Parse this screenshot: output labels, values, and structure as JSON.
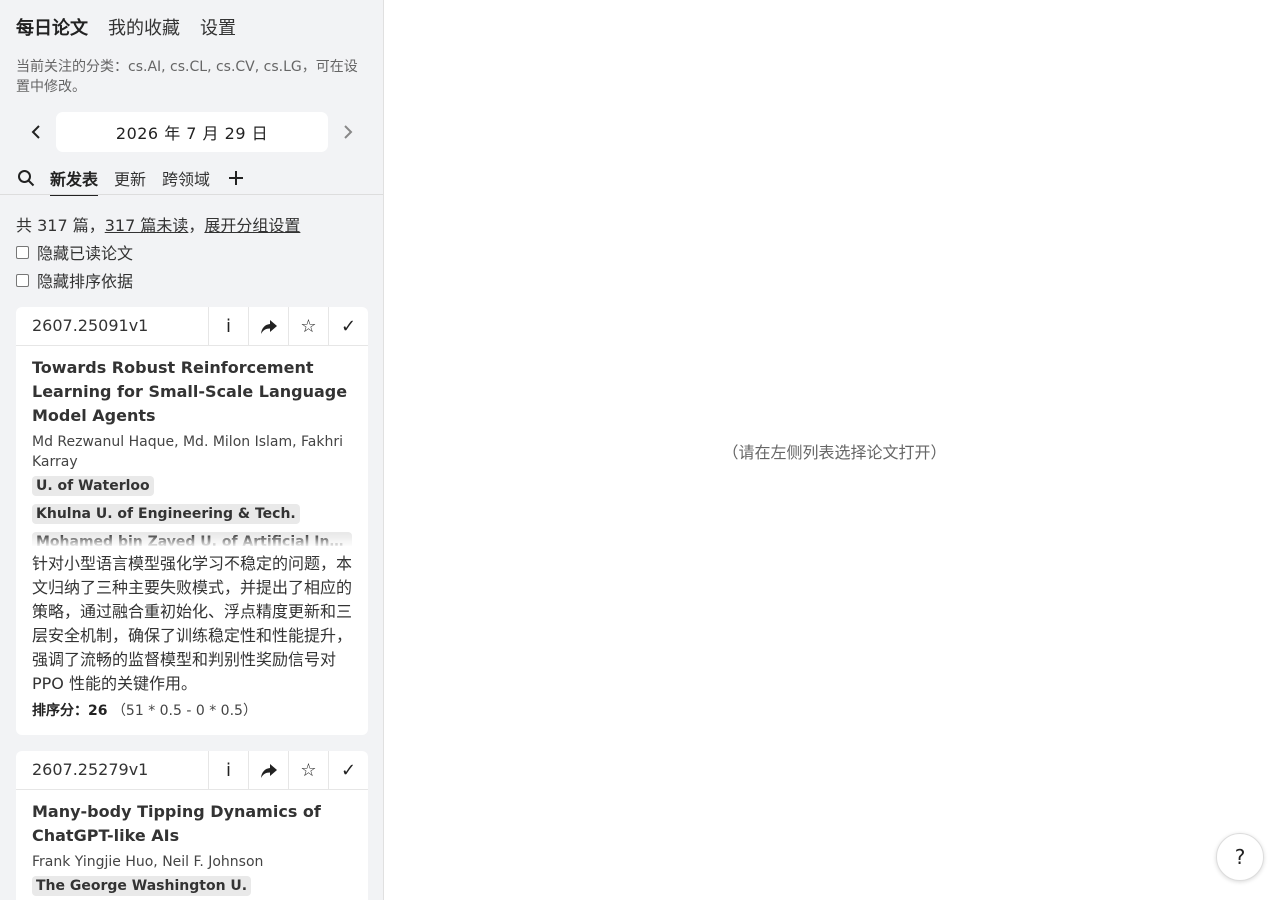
{
  "nav": {
    "daily": "每日论文",
    "favorites": "我的收藏",
    "settings": "设置"
  },
  "category_note": "当前关注的分类：cs.AI, cs.CL, cs.CV, cs.LG，可在设置中修改。",
  "date": {
    "label": "2026 年 7 月 29 日"
  },
  "tabs": {
    "new": "新发表",
    "updated": "更新",
    "cross": "跨领域",
    "add": "+"
  },
  "summary": {
    "total": "共 317 篇，",
    "unread": "317 篇未读",
    "sep": "，",
    "group_settings": "展开分组设置"
  },
  "filters": {
    "hide_read": "隐藏已读论文",
    "hide_ranking": "隐藏排序依据"
  },
  "papers": [
    {
      "id": "2607.25091v1",
      "title": "Towards Robust Reinforcement Learning for Small-Scale Language Model Agents",
      "authors": "Md Rezwanul Haque, Md. Milon Islam, Fakhri Karray",
      "affiliations": [
        "U. of Waterloo",
        "Khulna U. of Engineering & Tech.",
        "Mohamed bin Zayed U. of Artificial Intelligence"
      ],
      "summary": "针对小型语言模型强化学习不稳定的问题，本文归纳了三种主要失败模式，并提出了相应的策略，通过融合重初始化、浮点精度更新和三层安全机制，确保了训练稳定性和性能提升，强调了流畅的监督模型和判别性奖励信号对 PPO 性能的关键作用。",
      "score_label": "排序分：",
      "score": "26",
      "score_formula": "（51 * 0.5 - 0 * 0.5）"
    },
    {
      "id": "2607.25279v1",
      "title": "Many-body Tipping Dynamics of ChatGPT-like AIs",
      "authors": "Frank Yingjie Huo, Neil F. Johnson",
      "affiliations": [
        "The George Washington U."
      ]
    }
  ],
  "actions": {
    "info": "i",
    "share": "share-icon",
    "favorite": "☆",
    "mark_read": "✓"
  },
  "placeholder": "（请在左侧列表选择论文打开）",
  "help": "?"
}
